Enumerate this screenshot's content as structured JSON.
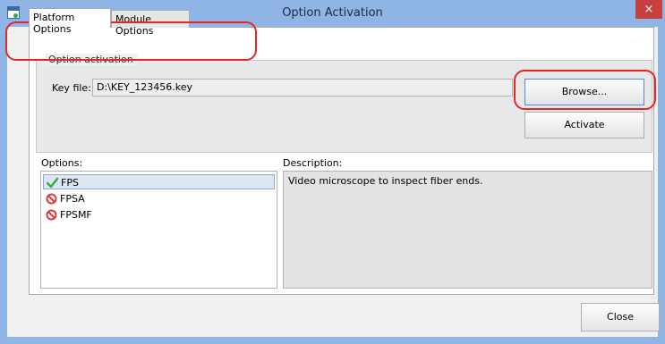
{
  "window": {
    "title": "Option Activation",
    "close_glyph": "×"
  },
  "tabs": [
    {
      "label": "Platform Options",
      "selected": true
    },
    {
      "label": "Module Options",
      "selected": false
    }
  ],
  "option_activation": {
    "legend": "Option activation",
    "key_file_label": "Key file:",
    "key_file_value": "D:\\KEY_123456.key",
    "browse_label": "Browse...",
    "activate_label": "Activate"
  },
  "options": {
    "label": "Options:",
    "items": [
      {
        "name": "FPS",
        "status": "active",
        "icon": "check-icon",
        "selected": true
      },
      {
        "name": "FPSA",
        "status": "inactive",
        "icon": "prohibited-icon",
        "selected": false
      },
      {
        "name": "FPSMF",
        "status": "inactive",
        "icon": "prohibited-icon",
        "selected": false
      }
    ]
  },
  "description": {
    "label": "Description:",
    "text": "Video microscope to inspect fiber ends."
  },
  "footer": {
    "close_label": "Close"
  },
  "colors": {
    "window_frame": "#8fb4e6",
    "close_button": "#c74040",
    "annotation": "#e32626",
    "check": "#3aa845",
    "prohibited": "#d83a3a"
  }
}
